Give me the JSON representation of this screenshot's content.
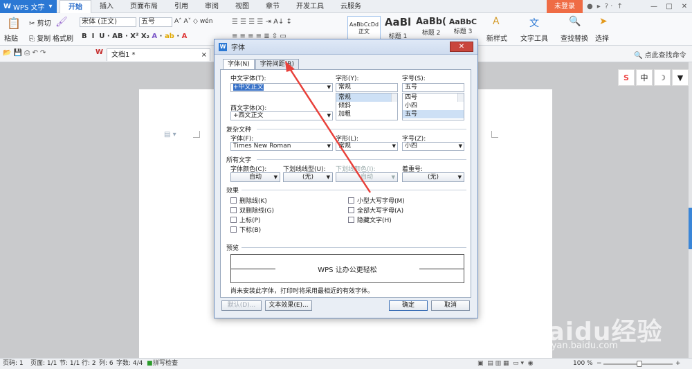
{
  "titlebar": {
    "app_name": "WPS 文字",
    "tabs": [
      "开始",
      "插入",
      "页面布局",
      "引用",
      "审阅",
      "视图",
      "章节",
      "开发工具",
      "云服务"
    ],
    "login": "未登录",
    "min": "—",
    "restore": "□",
    "close": "✕",
    "icons_text": "? ·"
  },
  "ribbon": {
    "paste": "粘贴",
    "cut": "剪切",
    "copy": "复制",
    "format_painter": "格式刷",
    "font_name": "宋体 (正文)",
    "font_size": "五号",
    "styles": [
      "AaBbCcDd",
      "AaBl",
      "AaBb(",
      "AaBbC"
    ],
    "style_names": [
      "正文",
      "标题 1",
      "标题 2",
      "标题 3"
    ],
    "new_style": "新样式",
    "text_tools": "文字工具",
    "find_replace": "查找替换",
    "select": "选择"
  },
  "quickbar": {
    "doc_tab": "文档1 *",
    "search_cmd": "点此查找命令"
  },
  "sidebar": {
    "b1": "S",
    "b2": "中",
    "b3": "☽",
    "b4": "▼"
  },
  "status": {
    "page_num": "页码: 1",
    "pages": "页面: 1/1",
    "section": "节: 1/1",
    "row": "行: 2",
    "col": "列: 6",
    "words": "字数: 4/4",
    "spell": "拼写检查",
    "zoom": "100 %"
  },
  "dialog": {
    "title": "字体",
    "close": "✕",
    "tabs": [
      "字体(N)",
      "字符间距(R)"
    ],
    "cn_font_label": "中文字体(T):",
    "cn_font_value": "+中文正文",
    "style_label": "字形(Y):",
    "style_value": "常规",
    "style_list": [
      "常规",
      "倾斜",
      "加粗"
    ],
    "size_label": "字号(S):",
    "size_value": "五号",
    "size_list": [
      "四号",
      "小四",
      "五号"
    ],
    "west_font_label": "西文字体(X):",
    "west_font_value": "+西文正文",
    "complex_section": "复杂文种",
    "complex_font_label": "字体(F):",
    "complex_font_value": "Times New Roman",
    "complex_style_label": "字形(L):",
    "complex_style_value": "常规",
    "complex_size_label": "字号(Z):",
    "complex_size_value": "小四",
    "all_text_section": "所有文字",
    "font_color_label": "字体颜色(C):",
    "font_color_value": "自动",
    "underline_label": "下划线线型(U):",
    "underline_value": "(无)",
    "underline_color_label": "下划线颜色(I):",
    "underline_color_value": "自动",
    "emphasis_label": "着重号:",
    "emphasis_value": "(无)",
    "effects_section": "效果",
    "effects_left": [
      "删除线(K)",
      "双删除线(G)",
      "上标(P)",
      "下标(B)"
    ],
    "effects_right": [
      "小型大写字母(M)",
      "全部大写字母(A)",
      "隐藏文字(H)"
    ],
    "preview_section": "预览",
    "preview_text": "WPS 让办公更轻松",
    "note": "尚未安装此字体，打印时将采用最相近的有效字体。",
    "default_btn": "默认(D)...",
    "text_effect_btn": "文本效果(E)...",
    "ok_btn": "确定",
    "cancel_btn": "取消"
  },
  "watermark": {
    "brand": "Baidu经验",
    "url": "jingyan.baidu.com"
  },
  "colors": {
    "accent": "#2b78d4",
    "login": "#ef6c45",
    "arrow": "#e8403a"
  }
}
